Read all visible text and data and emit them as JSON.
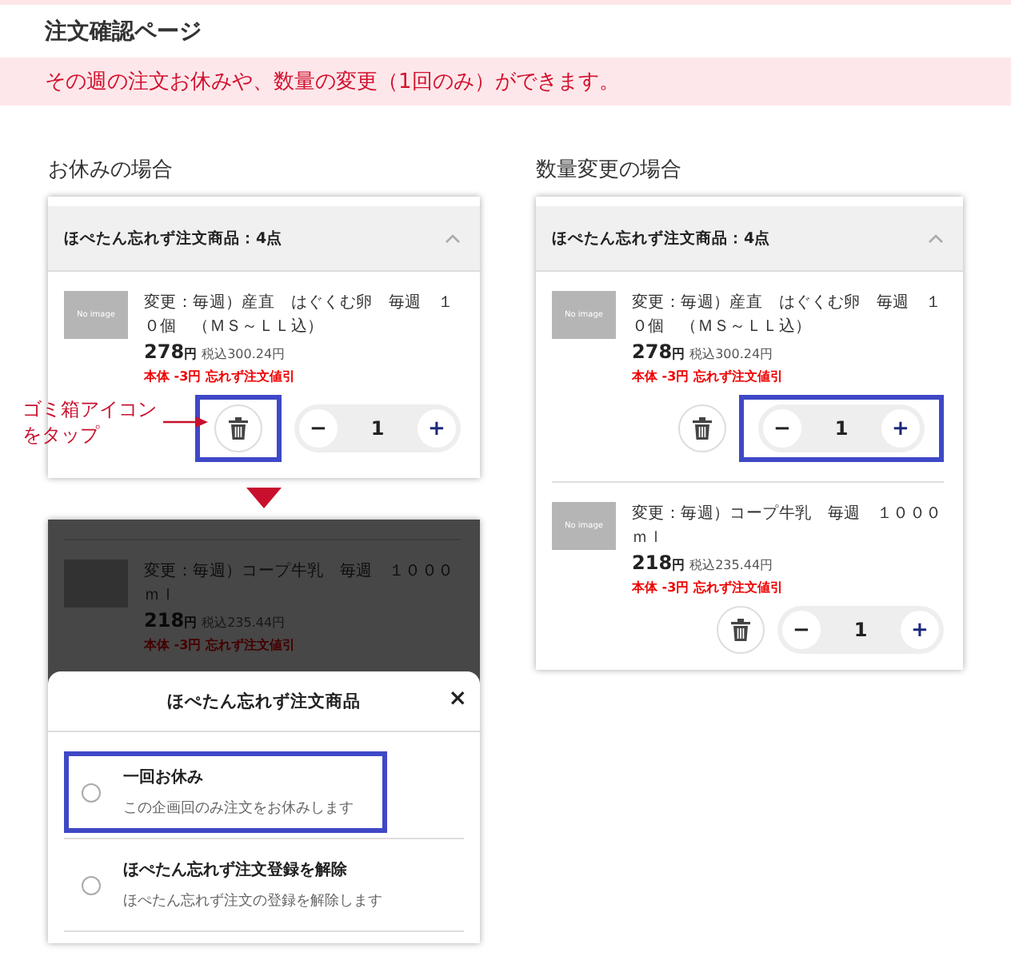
{
  "page_title": "注文確認ページ",
  "notice": "その週の注文お休みや、数量の変更（1回のみ）ができます。",
  "skip_case": {
    "label": "お休みの場合",
    "card": {
      "header": "ほぺたん忘れず注文商品：4点",
      "expanded": true,
      "items": [
        {
          "image": "No image",
          "name": "変更：毎週）産直　はぐくむ卵　毎週　１０個　（ＭＳ～ＬＬ込）",
          "price": "278",
          "unit": "円",
          "tax": "税込300.24円",
          "discount": "本体 -3円 忘れず注文値引",
          "minus": "−",
          "quantity": "1",
          "plus": "+",
          "trash_highlighted": true,
          "quantity_highlighted": false
        }
      ]
    },
    "callout": [
      "ゴミ箱アイコン",
      "をタップ"
    ]
  },
  "change_case": {
    "label": "数量変更の場合",
    "card": {
      "header": "ほぺたん忘れず注文商品：4点",
      "expanded": true,
      "items": [
        {
          "image": "No image",
          "name": "変更：毎週）産直　はぐくむ卵　毎週　１０個　（ＭＳ～ＬＬ込）",
          "price": "278",
          "unit": "円",
          "tax": "税込300.24円",
          "discount": "本体 -3円 忘れず注文値引",
          "minus": "−",
          "quantity": "1",
          "plus": "+",
          "trash_highlighted": false,
          "quantity_highlighted": true
        },
        {
          "image": "No image",
          "name": "変更：毎週）コープ牛乳　毎週　１０００ｍｌ",
          "price": "218",
          "unit": "円",
          "tax": "税込235.44円",
          "discount": "本体 -3円 忘れず注文値引",
          "minus": "−",
          "quantity": "1",
          "plus": "+",
          "trash_highlighted": false,
          "quantity_highlighted": false
        }
      ]
    }
  },
  "skip_result": {
    "dimmed_item": {
      "name": "変更：毎週）コープ牛乳　毎週　１０００ｍｌ",
      "price": "218",
      "unit": "円",
      "tax": "税込235.44円",
      "discount": "本体 -3円 忘れず注文値引"
    },
    "sheet": {
      "title": "ほぺたん忘れず注文商品",
      "close": "×",
      "options": [
        {
          "title": "一回お休み",
          "description": "この企画回のみ注文をお休みします",
          "selected": false,
          "highlighted": true
        },
        {
          "title": "ほぺたん忘れず注文登録を解除",
          "description": "ほぺたん忘れず注文の登録を解除します",
          "selected": false,
          "highlighted": false
        }
      ]
    }
  }
}
